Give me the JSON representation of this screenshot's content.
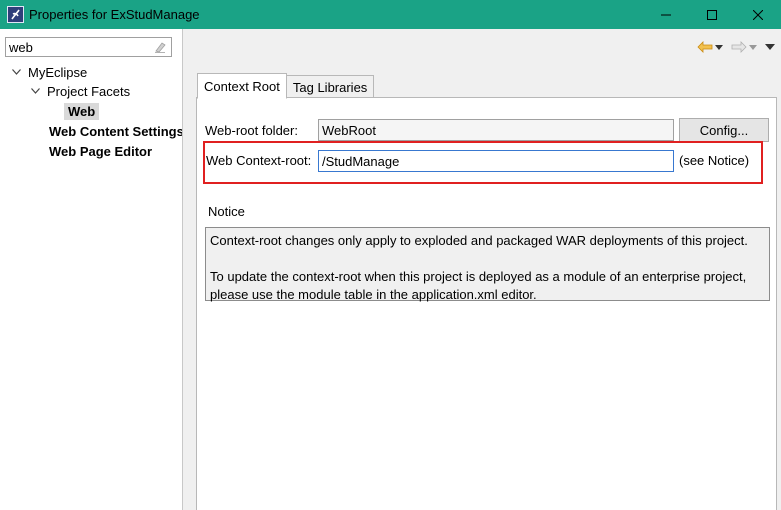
{
  "window": {
    "title": "Properties for ExStudManage",
    "icon": "myeclipse-icon"
  },
  "sidebar": {
    "filter_value": "web",
    "tree": [
      {
        "label": "MyEclipse",
        "expanded": true
      },
      {
        "label": "Project Facets",
        "expanded": true
      },
      {
        "label": "Web",
        "selected": true
      },
      {
        "label": "Web Content Settings"
      },
      {
        "label": "Web Page Editor"
      }
    ]
  },
  "tabs": [
    {
      "label": "Context Root",
      "active": true
    },
    {
      "label": "Tag Libraries",
      "active": false
    }
  ],
  "form": {
    "web_root_label": "Web-root folder:",
    "web_root_value": "WebRoot",
    "config_button": "Config...",
    "context_root_label": "Web Context-root:",
    "context_root_value": "/StudManage",
    "see_notice": "(see Notice)"
  },
  "notice": {
    "heading": "Notice",
    "line1": "Context-root changes only apply to exploded and packaged WAR deployments of this project.",
    "line2": "To update the context-root when this project is deployed as a module of an enterprise project, please use the module table in the application.xml editor."
  },
  "colors": {
    "titlebar": "#1aa386",
    "highlight": "#e02020",
    "nav_back": "#e8a317"
  }
}
